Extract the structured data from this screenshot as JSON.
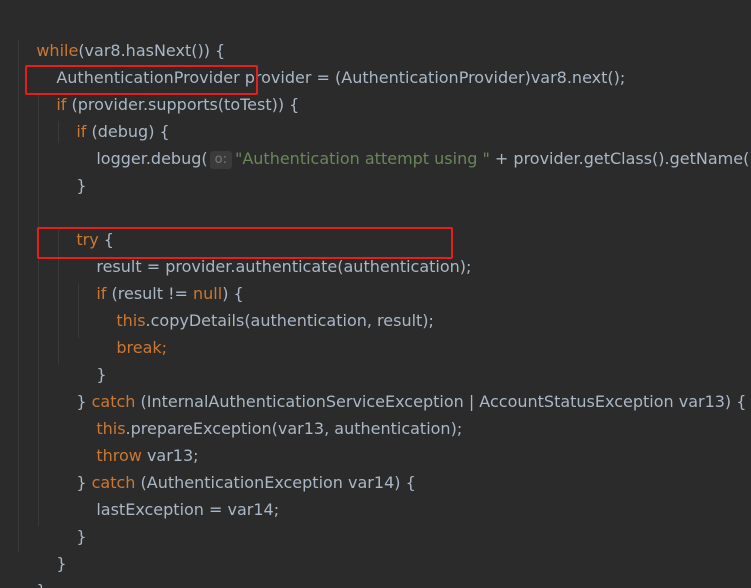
{
  "code": {
    "line_while": "while",
    "line_while_rest": "(var8.hasNext()) {",
    "line_provider": "AuthenticationProvider provider = (AuthenticationProvider)var8.next();",
    "line_if_kw": "if",
    "line_if_rest": " (provider.supports(toTest)) {",
    "line_ifdebug_kw": "if",
    "line_ifdebug_rest": " (debug) {",
    "line_logger_start": "logger.debug(",
    "line_logger_hint": "o:",
    "line_logger_string": "\"Authentication attempt using \"",
    "line_logger_end": " + provider.getClass().getName());",
    "line_close1": "}",
    "line_try_kw": "try",
    "line_try_rest": " {",
    "line_result": "result = provider.authenticate(authentication);",
    "line_ifresult_kw": "if",
    "line_ifresult_mid": " (result != ",
    "line_ifresult_null": "null",
    "line_ifresult_end": ") {",
    "line_this1_kw": "this",
    "line_this1_rest": ".copyDetails(authentication, result);",
    "line_break_kw": "break;",
    "line_close2": "}",
    "line_catch1_open": "} ",
    "line_catch1_kw": "catch",
    "line_catch1_rest": " (InternalAuthenticationServiceException | AccountStatusException var13) {",
    "line_this2_kw": "this",
    "line_this2_rest": ".prepareException(var13, authentication);",
    "line_throw_kw": "throw",
    "line_throw_rest": " var13;",
    "line_catch2_open": "} ",
    "line_catch2_kw": "catch",
    "line_catch2_rest": " (AuthenticationException var14) {",
    "line_lastexc": "lastException = var14;",
    "line_close3": "}",
    "line_close4": "}",
    "line_close5": "}"
  },
  "colors": {
    "background": "#2b2b2b",
    "keyword": "#cc7832",
    "string": "#6a8759",
    "plain": "#a9b7c6",
    "highlight": "#e51f1f"
  }
}
